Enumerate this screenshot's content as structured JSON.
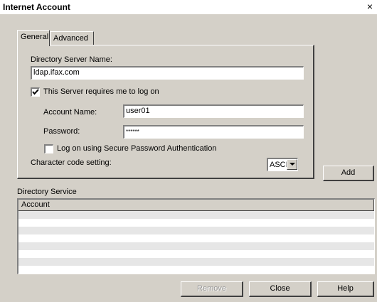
{
  "window": {
    "title": "Internet Account",
    "close_glyph": "×"
  },
  "tabs": [
    {
      "label": "General",
      "active": true
    },
    {
      "label": "Advanced",
      "active": false
    }
  ],
  "general": {
    "directory_server_label": "Directory Server Name:",
    "directory_server_value": "ldap.ifax.com",
    "requires_logon_label": "This Server requires me to log on",
    "requires_logon_checked": true,
    "account_name_label": "Account Name:",
    "account_name_value": "user01",
    "password_label": "Password:",
    "password_value": "******",
    "spa_label": "Log on using Secure Password Authentication",
    "spa_checked": false,
    "charset_label": "Character code setting:",
    "charset_value": "ASCII"
  },
  "buttons": {
    "add": "Add",
    "remove": "Remove",
    "close": "Close",
    "help": "Help"
  },
  "directory_service": {
    "section_label": "Directory Service",
    "column_header": "Account",
    "rows": []
  },
  "colors": {
    "face": "#d4d0c8",
    "alt_row": "#e6e6e6"
  }
}
